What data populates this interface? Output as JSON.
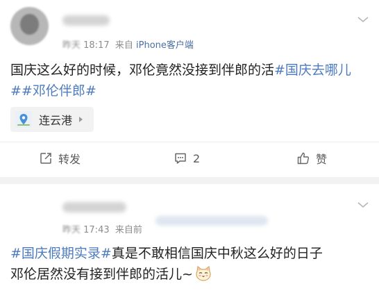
{
  "post1": {
    "username": "TingXi",
    "time_prefix": "昨天 ",
    "time": "18:17",
    "source_prefix": "来自",
    "source": "iPhone客户端",
    "content_text": "国庆这么好的时候，邓伦竟然没接到伴郎的活",
    "content_tags": [
      "#国庆去哪儿#",
      "#邓伦伴郎#"
    ],
    "location": "连云港",
    "actions": {
      "repost": "转发",
      "comment_count": "2",
      "like": "赞"
    }
  },
  "post2": {
    "username": "Jackmng",
    "time_prefix": "昨天 ",
    "time": "17:43",
    "source_prefix": "来自前",
    "content_tag": "#国庆假期实录#",
    "content_text_line1": "真是不敢相信国庆中秋这么好的日子",
    "content_text_line2": "邓伦居然没有接到伴郎的活儿~",
    "emoji": "cat-face-emoji"
  },
  "colors": {
    "background": "#f2f2f2",
    "card": "#ffffff",
    "link": "#4d7bbf",
    "meta": "#8c8c8c"
  }
}
